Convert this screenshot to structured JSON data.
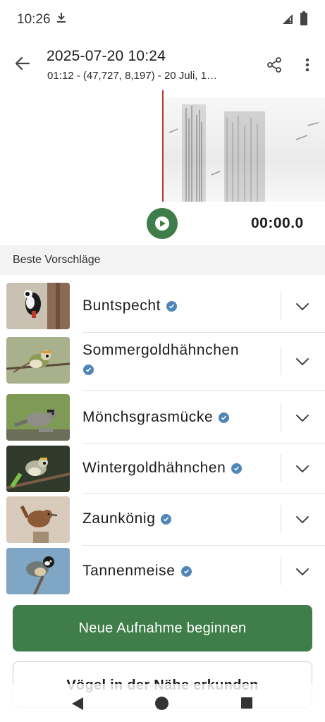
{
  "status_bar": {
    "time": "10:26",
    "icons": [
      "download-icon",
      "signal-icon",
      "battery-icon"
    ]
  },
  "app_bar": {
    "title": "2025-07-20 10:24",
    "subtitle": "01:12 - (47,727, 8,197) - 20 Juli, 1…",
    "icons": [
      "back-arrow-icon",
      "share-icon",
      "more-vert-icon"
    ]
  },
  "player": {
    "elapsed": "00:00.0",
    "play_icon": "play-icon"
  },
  "suggestions": {
    "header": "Beste Vorschläge",
    "items": [
      {
        "name": "Buntspecht",
        "verified": true,
        "wrap": false
      },
      {
        "name": "Sommergoldhähnchen",
        "verified": true,
        "wrap": true
      },
      {
        "name": "Mönchsgrasmücke",
        "verified": true,
        "wrap": false
      },
      {
        "name": "Wintergoldhähnchen",
        "verified": true,
        "wrap": false
      },
      {
        "name": "Zaunkönig",
        "verified": true,
        "wrap": false
      },
      {
        "name": "Tannenmeise",
        "verified": true,
        "wrap": false
      }
    ]
  },
  "actions": {
    "primary": "Neue Aufnahme beginnen",
    "secondary": "Vögel in der Nähe erkunden"
  },
  "colors": {
    "accent_green": "#3f7d4a",
    "verified_blue": "#4f86b8",
    "playhead_red": "#c0392b"
  }
}
